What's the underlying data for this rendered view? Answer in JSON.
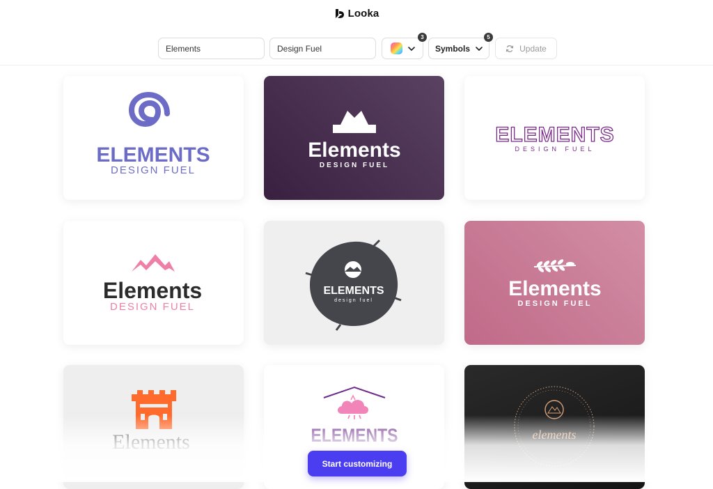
{
  "header": {
    "brand_name": "Looka",
    "logo_icon": "looka-logo-icon"
  },
  "toolbar": {
    "company_name_value": "Elements",
    "slogan_value": "Design Fuel",
    "colors_badge": "3",
    "symbols_label": "Symbols",
    "symbols_badge": "5",
    "update_label": "Update"
  },
  "logos": [
    {
      "name": "ELEMENTS",
      "slogan": "DESIGN FUEL",
      "symbol": "spiral-icon",
      "bg": "#ffffff",
      "accent": "#6c6cc6"
    },
    {
      "name": "Elements",
      "slogan": "DESIGN FUEL",
      "symbol": "crown-icon",
      "bg": "#3b2440",
      "accent": "#ffffff"
    },
    {
      "name": "ELEMENTS",
      "slogan": "DESIGN FUEL",
      "symbol": "none",
      "bg": "#ffffff",
      "accent": "#7a2b8a"
    },
    {
      "name": "Elements",
      "slogan": "DESIGN FUEL",
      "symbol": "mountains-icon",
      "bg": "#ffffff",
      "accent": "#ee7fa6"
    },
    {
      "name": "ELEMENTS",
      "slogan": "design fuel",
      "symbol": "mountain-sun-icon",
      "bg": "#efefef",
      "accent": "#45464b"
    },
    {
      "name": "Elements",
      "slogan": "DESIGN FUEL",
      "symbol": "laurel-icon",
      "bg": "#c2728e",
      "accent": "#ffffff"
    },
    {
      "name": "Elements",
      "slogan": "",
      "symbol": "castle-icon",
      "bg": "#eeeeee",
      "accent": "#ff6b2c"
    },
    {
      "name": "ELEMENTS",
      "slogan": "",
      "symbol": "cloud-roof-icon",
      "bg": "#ffffff",
      "accent": "#6b2a8c"
    },
    {
      "name": "elements",
      "slogan": "",
      "symbol": "circle-badge-icon",
      "bg": "#1f1f1f",
      "accent": "#d9a27a"
    }
  ],
  "cta": {
    "label": "Start customizing"
  }
}
